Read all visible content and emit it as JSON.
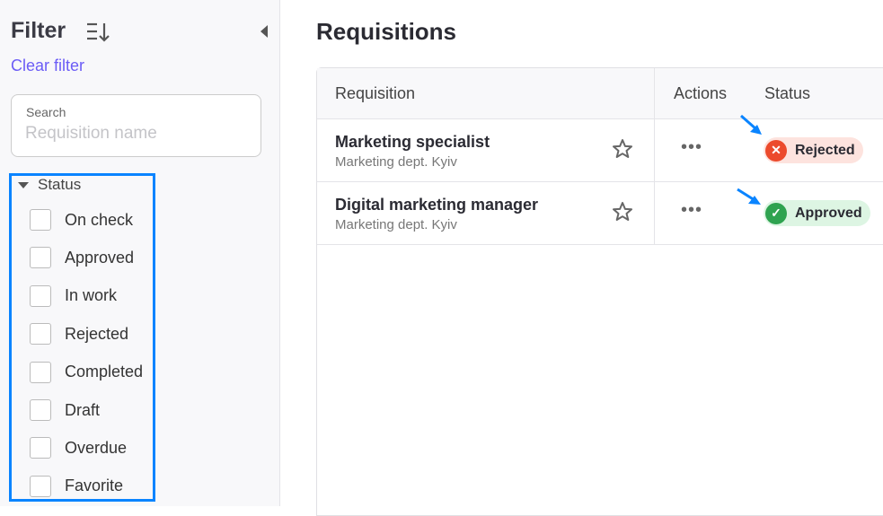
{
  "sidebar": {
    "title": "Filter",
    "clear_filter": "Clear filter",
    "search": {
      "label": "Search",
      "placeholder": "Requisition name",
      "value": ""
    },
    "status_group": {
      "label": "Status",
      "options": [
        "On check",
        "Approved",
        "In work",
        "Rejected",
        "Completed",
        "Draft",
        "Overdue",
        "Favorite"
      ]
    }
  },
  "main": {
    "title": "Requisitions",
    "columns": [
      "Requisition",
      "Actions",
      "Status"
    ],
    "rows": [
      {
        "name": "Marketing specialist",
        "dept": "Marketing dept. Kyiv",
        "status": "Rejected"
      },
      {
        "name": "Digital marketing manager",
        "dept": "Marketing dept. Kyiv",
        "status": "Approved"
      }
    ]
  },
  "colors": {
    "accent": "#6b5cf6",
    "highlight": "#0a84ff",
    "rejected_bg": "#fde3de",
    "rejected_icon": "#ec4a2c",
    "approved_bg": "#ddf5e3",
    "approved_icon": "#2fa350"
  }
}
